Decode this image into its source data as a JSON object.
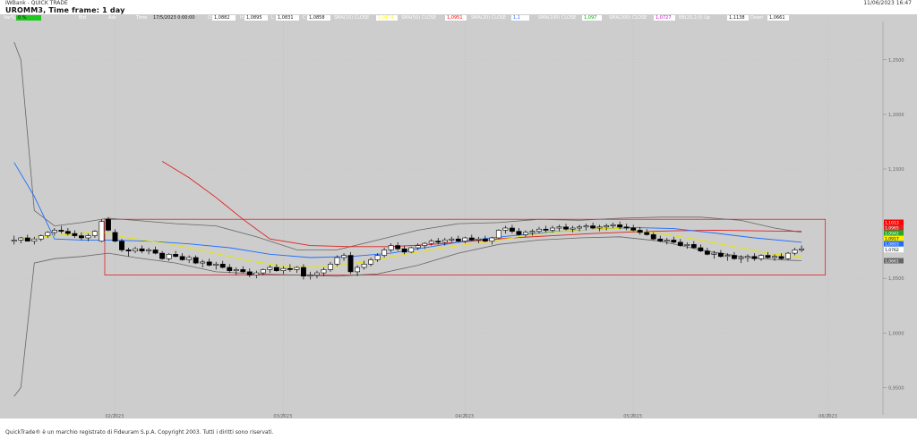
{
  "window": {
    "app_title": "IWBank - QUICK TRADE",
    "datetime": "11/06/2023 16:47",
    "symbol_line": "UROMM3, Time frame: 1 day"
  },
  "infobar": {
    "var_label": "Var%",
    "var_value": "0 %",
    "bid_label": "Bid",
    "ask_label": "Ask",
    "time_label": "Time",
    "time_value": "17/5/2023 0:00:00",
    "open_label": "O",
    "open_value": "1,0882",
    "high_label": "H",
    "high_value": "1,0895",
    "low_label": "L",
    "low_value": "1,0831",
    "close_label": "C",
    "close_value": "1,0858",
    "ind1_label": "SMA(10) CLOSE",
    "ind1_value": "1,0874",
    "ind1_color": "#ffff00",
    "ind2_label": "SMA(50) CLOSE",
    "ind2_value": "1,0951",
    "ind2_color": "#ff0000",
    "ind3_label": "SMA(20) CLOSE",
    "ind3_value": "1,1",
    "ind3_color": "#1e6eff",
    "ind4_label": "SMA(100) CLOSE",
    "ind4_value": "1,097",
    "ind4_color": "#00aa00",
    "ind5_label": "SMA(200) CLOSE",
    "ind5_value": "1,0727",
    "ind5_color": "#cc00cc",
    "ind6_label": "BB(20,2,0) Up",
    "ind6_value": "1,1138",
    "ind7_label": "Down",
    "ind7_value": "1,0661"
  },
  "price_axis": {
    "ticks": [
      "1,2500",
      "1,2000",
      "1,1500",
      "1,1000",
      "1,0500",
      "1,0000",
      "0,9500"
    ],
    "tags": [
      {
        "value": 1.1013,
        "label": "1,1013",
        "color": "#ff0000"
      },
      {
        "value": 1.0965,
        "label": "1,0965",
        "color": "#dd2222"
      },
      {
        "value": 1.0942,
        "label": "1,0942",
        "color": "#22aa22"
      },
      {
        "value": 1.0917,
        "label": "1,0917",
        "color": "#ffee00"
      },
      {
        "value": 1.0893,
        "label": "1,0893",
        "color": "#1e6eff"
      },
      {
        "value": 1.0762,
        "label": "1,0762",
        "color": "#ffffff"
      },
      {
        "value": 1.0661,
        "label": "1,0661",
        "color": "#666666"
      }
    ]
  },
  "date_axis": {
    "ticks": [
      "02/2023",
      "03/2023",
      "04/2023",
      "05/2023",
      "06/2023"
    ]
  },
  "chart_data": {
    "type": "candlestick",
    "ylim": [
      0.925,
      1.285
    ],
    "x_count": 128,
    "date_tick_positions": [
      15,
      40,
      67,
      92,
      121
    ],
    "candles": [
      [
        0,
        1.084,
        1.089,
        1.081,
        1.085
      ],
      [
        1,
        1.085,
        1.088,
        1.082,
        1.087
      ],
      [
        2,
        1.087,
        1.09,
        1.084,
        1.084
      ],
      [
        3,
        1.084,
        1.088,
        1.081,
        1.086
      ],
      [
        4,
        1.086,
        1.09,
        1.084,
        1.089
      ],
      [
        5,
        1.089,
        1.093,
        1.087,
        1.092
      ],
      [
        6,
        1.092,
        1.096,
        1.089,
        1.094
      ],
      [
        7,
        1.094,
        1.098,
        1.091,
        1.093
      ],
      [
        8,
        1.093,
        1.096,
        1.089,
        1.091
      ],
      [
        9,
        1.091,
        1.094,
        1.087,
        1.089
      ],
      [
        10,
        1.089,
        1.092,
        1.085,
        1.087
      ],
      [
        11,
        1.087,
        1.091,
        1.084,
        1.089
      ],
      [
        12,
        1.089,
        1.094,
        1.087,
        1.093
      ],
      [
        13,
        1.084,
        1.104,
        1.083,
        1.102
      ],
      [
        14,
        1.104,
        1.106,
        1.093,
        1.094
      ],
      [
        15,
        1.092,
        1.095,
        1.083,
        1.084
      ],
      [
        16,
        1.084,
        1.086,
        1.074,
        1.076
      ],
      [
        17,
        1.076,
        1.078,
        1.07,
        1.075
      ],
      [
        18,
        1.075,
        1.079,
        1.073,
        1.077
      ],
      [
        19,
        1.077,
        1.08,
        1.073,
        1.075
      ],
      [
        20,
        1.075,
        1.078,
        1.072,
        1.076
      ],
      [
        21,
        1.076,
        1.079,
        1.072,
        1.073
      ],
      [
        22,
        1.073,
        1.075,
        1.067,
        1.068
      ],
      [
        23,
        1.068,
        1.073,
        1.066,
        1.072
      ],
      [
        24,
        1.072,
        1.075,
        1.069,
        1.07
      ],
      [
        25,
        1.07,
        1.073,
        1.066,
        1.067
      ],
      [
        26,
        1.067,
        1.071,
        1.064,
        1.069
      ],
      [
        27,
        1.069,
        1.071,
        1.063,
        1.064
      ],
      [
        28,
        1.064,
        1.067,
        1.06,
        1.065
      ],
      [
        29,
        1.065,
        1.068,
        1.061,
        1.062
      ],
      [
        30,
        1.062,
        1.065,
        1.058,
        1.063
      ],
      [
        31,
        1.063,
        1.066,
        1.059,
        1.06
      ],
      [
        32,
        1.06,
        1.063,
        1.055,
        1.057
      ],
      [
        33,
        1.057,
        1.06,
        1.053,
        1.058
      ],
      [
        34,
        1.058,
        1.061,
        1.055,
        1.056
      ],
      [
        35,
        1.056,
        1.059,
        1.051,
        1.053
      ],
      [
        36,
        1.053,
        1.057,
        1.05,
        1.055
      ],
      [
        37,
        1.055,
        1.059,
        1.053,
        1.058
      ],
      [
        38,
        1.058,
        1.062,
        1.055,
        1.06
      ],
      [
        39,
        1.06,
        1.063,
        1.056,
        1.057
      ],
      [
        40,
        1.057,
        1.061,
        1.054,
        1.059
      ],
      [
        41,
        1.059,
        1.063,
        1.056,
        1.058
      ],
      [
        42,
        1.058,
        1.061,
        1.055,
        1.06
      ],
      [
        43,
        1.06,
        1.063,
        1.049,
        1.052
      ],
      [
        44,
        1.052,
        1.056,
        1.049,
        1.053
      ],
      [
        45,
        1.053,
        1.057,
        1.05,
        1.055
      ],
      [
        46,
        1.055,
        1.06,
        1.052,
        1.058
      ],
      [
        47,
        1.058,
        1.065,
        1.056,
        1.063
      ],
      [
        48,
        1.063,
        1.071,
        1.061,
        1.069
      ],
      [
        49,
        1.069,
        1.073,
        1.066,
        1.071
      ],
      [
        50,
        1.071,
        1.074,
        1.054,
        1.056
      ],
      [
        51,
        1.056,
        1.062,
        1.052,
        1.06
      ],
      [
        52,
        1.06,
        1.066,
        1.058,
        1.063
      ],
      [
        53,
        1.063,
        1.069,
        1.061,
        1.067
      ],
      [
        54,
        1.067,
        1.073,
        1.065,
        1.071
      ],
      [
        55,
        1.071,
        1.078,
        1.069,
        1.076
      ],
      [
        56,
        1.076,
        1.082,
        1.074,
        1.08
      ],
      [
        57,
        1.08,
        1.083,
        1.075,
        1.077
      ],
      [
        58,
        1.077,
        1.08,
        1.072,
        1.074
      ],
      [
        59,
        1.074,
        1.079,
        1.073,
        1.078
      ],
      [
        60,
        1.078,
        1.082,
        1.076,
        1.08
      ],
      [
        61,
        1.08,
        1.083,
        1.077,
        1.082
      ],
      [
        62,
        1.082,
        1.086,
        1.08,
        1.084
      ],
      [
        63,
        1.084,
        1.087,
        1.081,
        1.083
      ],
      [
        64,
        1.083,
        1.087,
        1.08,
        1.085
      ],
      [
        65,
        1.085,
        1.088,
        1.083,
        1.086
      ],
      [
        66,
        1.086,
        1.089,
        1.083,
        1.084
      ],
      [
        67,
        1.084,
        1.088,
        1.082,
        1.087
      ],
      [
        68,
        1.087,
        1.09,
        1.084,
        1.085
      ],
      [
        69,
        1.085,
        1.088,
        1.082,
        1.086
      ],
      [
        70,
        1.086,
        1.089,
        1.083,
        1.084
      ],
      [
        71,
        1.084,
        1.088,
        1.081,
        1.087
      ],
      [
        72,
        1.087,
        1.095,
        1.086,
        1.094
      ],
      [
        73,
        1.094,
        1.098,
        1.091,
        1.096
      ],
      [
        74,
        1.096,
        1.099,
        1.091,
        1.093
      ],
      [
        75,
        1.093,
        1.096,
        1.089,
        1.09
      ],
      [
        76,
        1.09,
        1.094,
        1.088,
        1.092
      ],
      [
        77,
        1.092,
        1.095,
        1.089,
        1.093
      ],
      [
        78,
        1.093,
        1.097,
        1.091,
        1.095
      ],
      [
        79,
        1.095,
        1.098,
        1.092,
        1.094
      ],
      [
        80,
        1.094,
        1.098,
        1.092,
        1.096
      ],
      [
        81,
        1.096,
        1.099,
        1.093,
        1.097
      ],
      [
        82,
        1.097,
        1.1,
        1.094,
        1.095
      ],
      [
        83,
        1.095,
        1.098,
        1.092,
        1.096
      ],
      [
        84,
        1.096,
        1.099,
        1.093,
        1.097
      ],
      [
        85,
        1.097,
        1.1,
        1.094,
        1.098
      ],
      [
        86,
        1.098,
        1.101,
        1.095,
        1.096
      ],
      [
        87,
        1.096,
        1.099,
        1.093,
        1.097
      ],
      [
        88,
        1.097,
        1.1,
        1.094,
        1.098
      ],
      [
        89,
        1.098,
        1.101,
        1.096,
        1.099
      ],
      [
        90,
        1.099,
        1.102,
        1.095,
        1.097
      ],
      [
        91,
        1.097,
        1.1,
        1.094,
        1.096
      ],
      [
        92,
        1.096,
        1.099,
        1.093,
        1.094
      ],
      [
        93,
        1.094,
        1.097,
        1.09,
        1.092
      ],
      [
        94,
        1.092,
        1.095,
        1.089,
        1.09
      ],
      [
        95,
        1.09,
        1.092,
        1.085,
        1.086
      ],
      [
        96,
        1.086,
        1.089,
        1.083,
        1.084
      ],
      [
        97,
        1.084,
        1.087,
        1.081,
        1.085
      ],
      [
        98,
        1.085,
        1.088,
        1.082,
        1.083
      ],
      [
        99,
        1.083,
        1.086,
        1.079,
        1.08
      ],
      [
        100,
        1.08,
        1.083,
        1.077,
        1.081
      ],
      [
        101,
        1.081,
        1.084,
        1.077,
        1.078
      ],
      [
        102,
        1.078,
        1.081,
        1.074,
        1.075
      ],
      [
        103,
        1.075,
        1.078,
        1.071,
        1.072
      ],
      [
        104,
        1.072,
        1.075,
        1.068,
        1.073
      ],
      [
        105,
        1.073,
        1.076,
        1.069,
        1.07
      ],
      [
        106,
        1.07,
        1.073,
        1.066,
        1.071
      ],
      [
        107,
        1.071,
        1.074,
        1.067,
        1.068
      ],
      [
        108,
        1.068,
        1.071,
        1.064,
        1.069
      ],
      [
        109,
        1.069,
        1.072,
        1.065,
        1.07
      ],
      [
        110,
        1.07,
        1.073,
        1.066,
        1.068
      ],
      [
        111,
        1.068,
        1.072,
        1.066,
        1.071
      ],
      [
        112,
        1.071,
        1.074,
        1.068,
        1.069
      ],
      [
        113,
        1.069,
        1.072,
        1.066,
        1.07
      ],
      [
        114,
        1.07,
        1.073,
        1.067,
        1.068
      ],
      [
        115,
        1.068,
        1.074,
        1.067,
        1.073
      ],
      [
        116,
        1.073,
        1.078,
        1.071,
        1.076
      ],
      [
        117,
        1.076,
        1.08,
        1.074,
        1.077
      ]
    ],
    "sma_yellow": [
      [
        1,
        1.0865
      ],
      [
        5,
        1.0885
      ],
      [
        9,
        1.0905
      ],
      [
        13,
        1.0925
      ],
      [
        17,
        1.087
      ],
      [
        23,
        1.0815
      ],
      [
        29,
        1.074
      ],
      [
        35,
        1.066
      ],
      [
        41,
        1.06
      ],
      [
        47,
        1.0605
      ],
      [
        53,
        1.066
      ],
      [
        59,
        1.073
      ],
      [
        65,
        1.079
      ],
      [
        71,
        1.084
      ],
      [
        77,
        1.09
      ],
      [
        83,
        1.094
      ],
      [
        89,
        1.096
      ],
      [
        95,
        1.092
      ],
      [
        101,
        1.086
      ],
      [
        107,
        1.079
      ],
      [
        113,
        1.072
      ],
      [
        117,
        1.07
      ]
    ],
    "sma_blue": [
      [
        0,
        1.156
      ],
      [
        3,
        1.125
      ],
      [
        6,
        1.086
      ],
      [
        10,
        1.085
      ],
      [
        14,
        1.085
      ],
      [
        20,
        1.084
      ],
      [
        26,
        1.0815
      ],
      [
        32,
        1.078
      ],
      [
        38,
        1.072
      ],
      [
        44,
        1.069
      ],
      [
        50,
        1.07
      ],
      [
        56,
        1.073
      ],
      [
        62,
        1.079
      ],
      [
        68,
        1.085
      ],
      [
        74,
        1.089
      ],
      [
        80,
        1.0925
      ],
      [
        86,
        1.095
      ],
      [
        92,
        1.0965
      ],
      [
        98,
        1.0955
      ],
      [
        104,
        1.0915
      ],
      [
        110,
        1.087
      ],
      [
        117,
        1.083
      ]
    ],
    "sma_red": [
      [
        22,
        1.157
      ],
      [
        26,
        1.142
      ],
      [
        30,
        1.124
      ],
      [
        34,
        1.104
      ],
      [
        38,
        1.086
      ],
      [
        44,
        1.08
      ],
      [
        50,
        1.079
      ],
      [
        56,
        1.079
      ],
      [
        62,
        1.081
      ],
      [
        68,
        1.084
      ],
      [
        74,
        1.087
      ],
      [
        80,
        1.089
      ],
      [
        86,
        1.091
      ],
      [
        92,
        1.0925
      ],
      [
        98,
        1.0935
      ],
      [
        104,
        1.094
      ],
      [
        110,
        1.0935
      ],
      [
        117,
        1.093
      ]
    ],
    "bb_upper": [
      [
        0,
        1.266
      ],
      [
        1,
        1.25
      ],
      [
        3,
        1.112
      ],
      [
        6,
        1.098
      ],
      [
        10,
        1.101
      ],
      [
        14,
        1.105
      ],
      [
        18,
        1.103
      ],
      [
        24,
        1.1
      ],
      [
        30,
        1.098
      ],
      [
        36,
        1.088
      ],
      [
        42,
        1.076
      ],
      [
        48,
        1.076
      ],
      [
        54,
        1.085
      ],
      [
        60,
        1.094
      ],
      [
        66,
        1.1
      ],
      [
        72,
        1.101
      ],
      [
        78,
        1.104
      ],
      [
        84,
        1.103
      ],
      [
        90,
        1.105
      ],
      [
        96,
        1.106
      ],
      [
        102,
        1.106
      ],
      [
        108,
        1.103
      ],
      [
        113,
        1.096
      ],
      [
        117,
        1.092
      ]
    ],
    "bb_lower": [
      [
        0,
        0.942
      ],
      [
        1,
        0.95
      ],
      [
        3,
        1.064
      ],
      [
        6,
        1.068
      ],
      [
        10,
        1.07
      ],
      [
        14,
        1.073
      ],
      [
        18,
        1.069
      ],
      [
        24,
        1.064
      ],
      [
        30,
        1.056
      ],
      [
        36,
        1.054
      ],
      [
        42,
        1.053
      ],
      [
        48,
        1.052
      ],
      [
        54,
        1.054
      ],
      [
        60,
        1.062
      ],
      [
        66,
        1.073
      ],
      [
        72,
        1.081
      ],
      [
        78,
        1.085
      ],
      [
        84,
        1.087
      ],
      [
        90,
        1.088
      ],
      [
        96,
        1.084
      ],
      [
        102,
        1.076
      ],
      [
        108,
        1.07
      ],
      [
        113,
        1.067
      ],
      [
        117,
        1.0661
      ]
    ],
    "annotation_box": {
      "x0": 14,
      "x1": 120,
      "y_low": 1.053,
      "y_high": 1.104
    }
  },
  "footer": {
    "copyright": "QuickTrade® è un marchio registrato di Fideuram S.p.A. Copyright 2003. Tutti i diritti sono riservati."
  }
}
